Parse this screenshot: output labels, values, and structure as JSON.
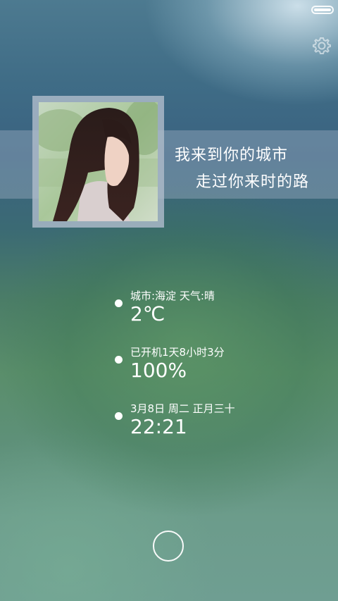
{
  "status_bar": {
    "battery_icon": "battery-full-icon",
    "battery_level": 1.0
  },
  "settings": {
    "icon": "gear-icon"
  },
  "quote": {
    "line1": "我来到你的城市",
    "line2": "走过你来时的路"
  },
  "info": [
    {
      "label": "城市:海淀  天气:晴",
      "value": "2℃"
    },
    {
      "label": "已开机1天8小时3分",
      "value": "100%"
    },
    {
      "label": "3月8日 周二 正月三十",
      "value": "22:21"
    }
  ],
  "home": {
    "icon": "circle-home-icon"
  }
}
